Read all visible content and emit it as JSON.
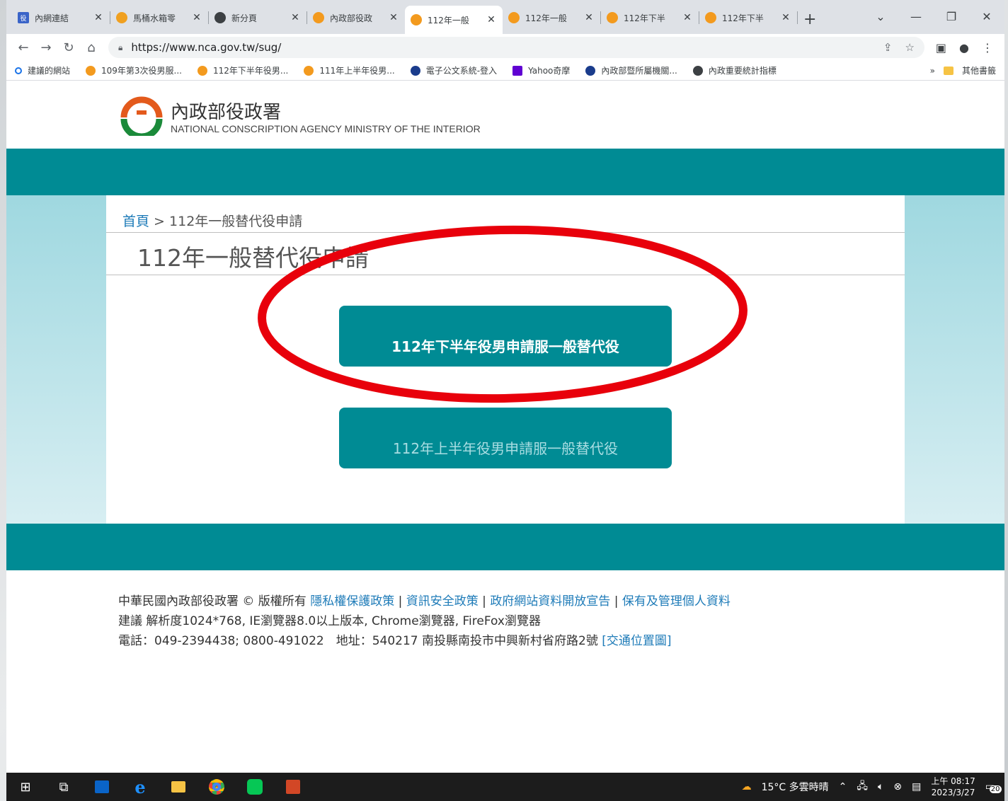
{
  "browser": {
    "tabs": [
      {
        "label": "內網連結",
        "active": false
      },
      {
        "label": "馬桶水箱零",
        "active": false
      },
      {
        "label": "新分頁",
        "active": false
      },
      {
        "label": "內政部役政",
        "active": false
      },
      {
        "label": "112年一般",
        "active": true
      },
      {
        "label": "112年一般",
        "active": false
      },
      {
        "label": "112年下半",
        "active": false
      },
      {
        "label": "112年下半",
        "active": false
      }
    ],
    "url": "https://www.nca.gov.tw/sug/",
    "bookmarks": [
      "建議的網站",
      "109年第3次役男服...",
      "112年下半年役男...",
      "111年上半年役男...",
      "電子公文系統-登入",
      "Yahoo奇摩",
      "內政部暨所屬機關...",
      "內政重要統計指標"
    ],
    "other_bookmarks": "其他書籤",
    "more_bookmarks": "»"
  },
  "site": {
    "title": "內政部役政署",
    "subtitle": "NATIONAL CONSCRIPTION AGENCY MINISTRY OF THE INTERIOR"
  },
  "breadcrumb": {
    "home": "首頁",
    "separator": " > ",
    "current": "112年一般替代役申請"
  },
  "page_title": "112年一般替代役申請",
  "buttons": {
    "second_half": "112年下半年役男申請服一般替代役",
    "first_half": "112年上半年役男申請服一般替代役"
  },
  "footer": {
    "copyright": "中華民國內政部役政署 © 版權所有 ",
    "links": [
      "隱私權保護政策",
      "資訊安全政策",
      "政府網站資料開放宣告",
      "保有及管理個人資料"
    ],
    "sep": " | ",
    "line2": "建議 解析度1024*768, IE瀏覽器8.0以上版本, Chrome瀏覽器, FireFox瀏覽器",
    "line3": "電話：049-2394438; 0800-491022　地址：540217 南投縣南投市中興新村省府路2號 ",
    "map_link": "[交通位置圖]"
  },
  "taskbar": {
    "weather": "15°C 多雲時晴",
    "time": "上午 08:17",
    "date": "2023/3/27",
    "notifications": "20"
  },
  "colors": {
    "teal": "#008b94",
    "annotation_red": "#e8000b",
    "link": "#1e7bb8"
  }
}
